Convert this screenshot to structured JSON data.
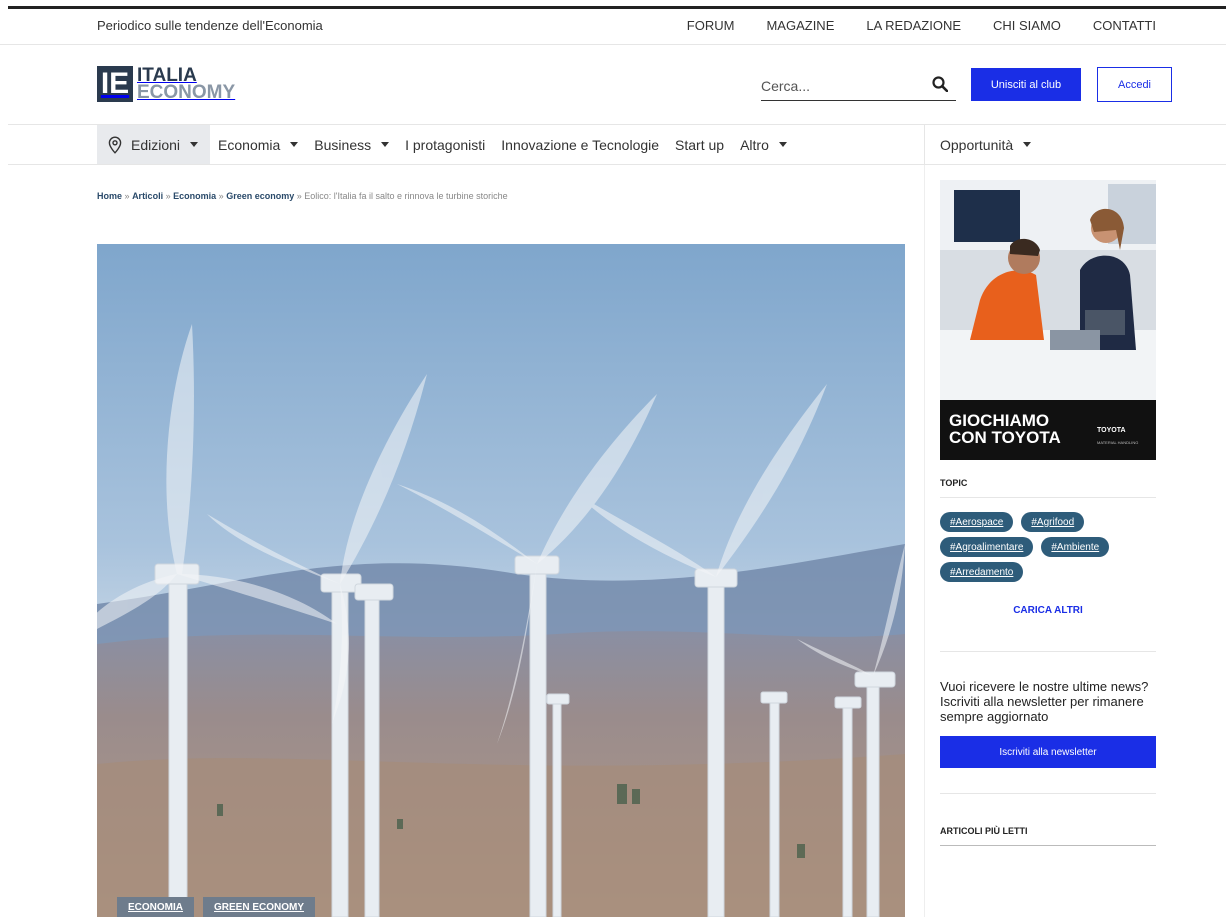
{
  "header": {
    "tagline": "Periodico sulle tendenze dell'Economia",
    "top_nav": [
      "FORUM",
      "MAGAZINE",
      "LA REDAZIONE",
      "CHI SIAMO",
      "CONTATTI"
    ],
    "logo": {
      "mark": "IE",
      "line1": "ITALIA",
      "line2": "ECONOMY"
    },
    "search": {
      "placeholder": "Cerca...",
      "icon": "search-icon"
    },
    "join_button": "Unisciti al club",
    "login_button": "Accedi"
  },
  "nav": {
    "items": [
      {
        "label": "Edizioni",
        "dropdown": true,
        "icon": "location-pin-icon"
      },
      {
        "label": "Economia",
        "dropdown": true
      },
      {
        "label": "Business",
        "dropdown": true
      },
      {
        "label": "I protagonisti",
        "dropdown": false
      },
      {
        "label": "Innovazione e Tecnologie",
        "dropdown": false
      },
      {
        "label": "Start up",
        "dropdown": false
      },
      {
        "label": "Altro",
        "dropdown": true
      }
    ],
    "right_item": {
      "label": "Opportunità",
      "dropdown": true
    }
  },
  "breadcrumb": {
    "links": [
      "Home",
      "Articoli",
      "Economia",
      "Green economy"
    ],
    "current": "Eolico: l'Italia fa il salto e rinnova le turbine storiche",
    "separator": "»"
  },
  "article": {
    "hero_description": "wind-turbines-photo",
    "tags": [
      "ECONOMIA",
      "GREEN ECONOMY"
    ]
  },
  "sidebar": {
    "ad": {
      "headline": "GIOCHIAMO CON TOYOTA",
      "brand": "TOYOTA",
      "brand_sub": "MATERIAL HANDLING"
    },
    "topic": {
      "title": "TOPIC",
      "chips": [
        "#Aerospace",
        "#Agrifood",
        "#Agroalimentare",
        "#Ambiente",
        "#Arredamento"
      ],
      "load_more": "CARICA ALTRI"
    },
    "newsletter": {
      "text": "Vuoi ricevere le nostre ultime news? Iscriviti alla newsletter per rimanere sempre aggiornato",
      "button": "Iscriviti alla newsletter"
    },
    "most_read_title": "ARTICOLI PIÙ LETTI"
  },
  "colors": {
    "accent": "#1a2ee6",
    "brand_dark": "#2a3a4e",
    "chip": "#2e5c7a",
    "tag_overlay": "#6e7c8c"
  }
}
